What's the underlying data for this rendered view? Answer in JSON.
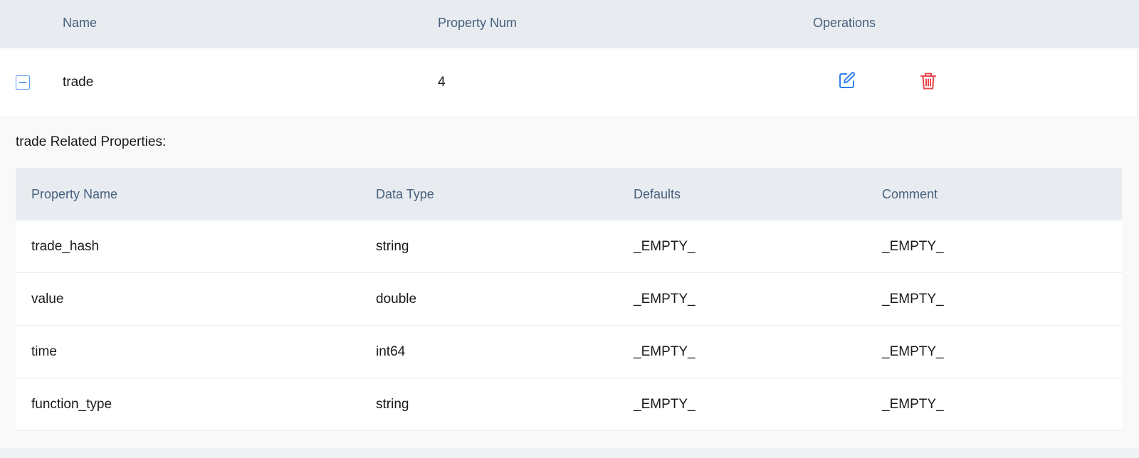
{
  "outer_table": {
    "columns": [
      "Name",
      "Property Num",
      "Operations"
    ],
    "row": {
      "name": "trade",
      "property_num": "4",
      "operations": [
        "edit-icon",
        "delete-icon"
      ]
    }
  },
  "expanded": {
    "title": "trade Related Properties:",
    "columns": [
      "Property Name",
      "Data Type",
      "Defaults",
      "Comment"
    ],
    "rows": [
      [
        "trade_hash",
        "string",
        "_EMPTY_",
        "_EMPTY_"
      ],
      [
        "value",
        "double",
        "_EMPTY_",
        "_EMPTY_"
      ],
      [
        "time",
        "int64",
        "_EMPTY_",
        "_EMPTY_"
      ],
      [
        "function_type",
        "string",
        "_EMPTY_",
        "_EMPTY_"
      ]
    ]
  },
  "colors": {
    "header_bg": "#e8ecf0",
    "header_text": "#46607e",
    "edit_icon": "#2f7ff0",
    "delete_icon": "#e8464d",
    "collapse_border": "#5b9cf0"
  }
}
